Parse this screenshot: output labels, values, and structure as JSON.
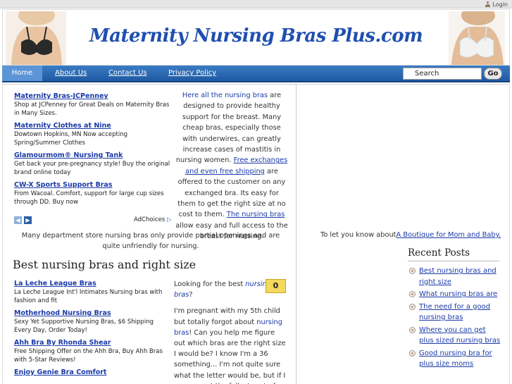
{
  "topbar": {
    "login_label": "Login"
  },
  "header": {
    "title": "Maternity Nursing Bras Plus.com"
  },
  "nav": {
    "home": "Home",
    "about": "About Us",
    "contact": "Contact Us",
    "privacy": "Privacy Policy",
    "search_value": "Search",
    "go_label": "Go"
  },
  "ads_top": [
    {
      "title": "Maternity Bras-JCPenney",
      "desc": "Shop at JCPenney for Great Deals on Maternity Bras in Many Sizes."
    },
    {
      "title": "Maternity Clothes at Nine",
      "desc": "Dowtown Hopkins, MN Now accepting Spring/Summer Clothes"
    },
    {
      "title": "Glamourmom® Nursing Tank",
      "desc": "Get back your pre-pregnancy style! Buy the original brand online today"
    },
    {
      "title": "CW-X Sports Support Bras",
      "desc": "From Wacoal. Comfort, support for large cup sizes through DD. Buy now"
    }
  ],
  "adchoices_label": "AdChoices",
  "intro": {
    "link1": "Here all the nursing bras",
    "text1": " are designed to provide healthy support for the breast. Many cheap bras, especially those with underwires, can greatly increase cases of mastitis in nursing women. ",
    "link2": "Free exchanges and even free shipping",
    "text2": " are offered to the customer on any exchanged bra. Its easy for them to get the right size at no cost to them. ",
    "link3": "The nursing bras",
    "text3": " allow easy and full access to the breast for nursing."
  },
  "intro_full": "Many department store nursing bras only provide partial openings and are quite unfriendly for nursing.",
  "section_title": "Best nursing bras and right size",
  "ads_bottom": [
    {
      "title": "La Leche League Bras",
      "desc": "La Leche League Int'l Intimates Nursing bras with fashion and fit"
    },
    {
      "title": "Motherhood Nursing Bras",
      "desc": "Sexy Yet Supportive Nursing Bras, $6 Shipping Every Day, Order Today!"
    },
    {
      "title": "Ahh Bra By Rhonda Shear",
      "desc": "Free Shipping Offer on the Ahh Bra, Buy Ahh Bras with 5-Star Reviews!"
    },
    {
      "title": "Enjoy Genie Bra Comfort",
      "desc": ""
    }
  ],
  "post": {
    "lead_text": "Looking for the best ",
    "lead_link": "nursing bras",
    "lead_end": "?",
    "body1": "I'm pregnant with my 5th child but totally forgot about ",
    "body_link": "nursing bras",
    "body2": "! Can you help me figure out which bras are the right size I would be? I know I'm a 36 something... I'm not quite sure what the letter would be, but if I measure at the fullest part of my",
    "comment_count": "0"
  },
  "sidebar": {
    "boutique_text": "To let you know about",
    "boutique_link": "A Boutique for Mom and Baby.",
    "recent_title": "Recent Posts",
    "recent_posts": [
      "Best nursing bras and right size",
      "What nursing bras are",
      "The need for a good nursing bras",
      "Where you can get plus sized nursing bras",
      "Good nursing bra for plus size moms"
    ]
  }
}
